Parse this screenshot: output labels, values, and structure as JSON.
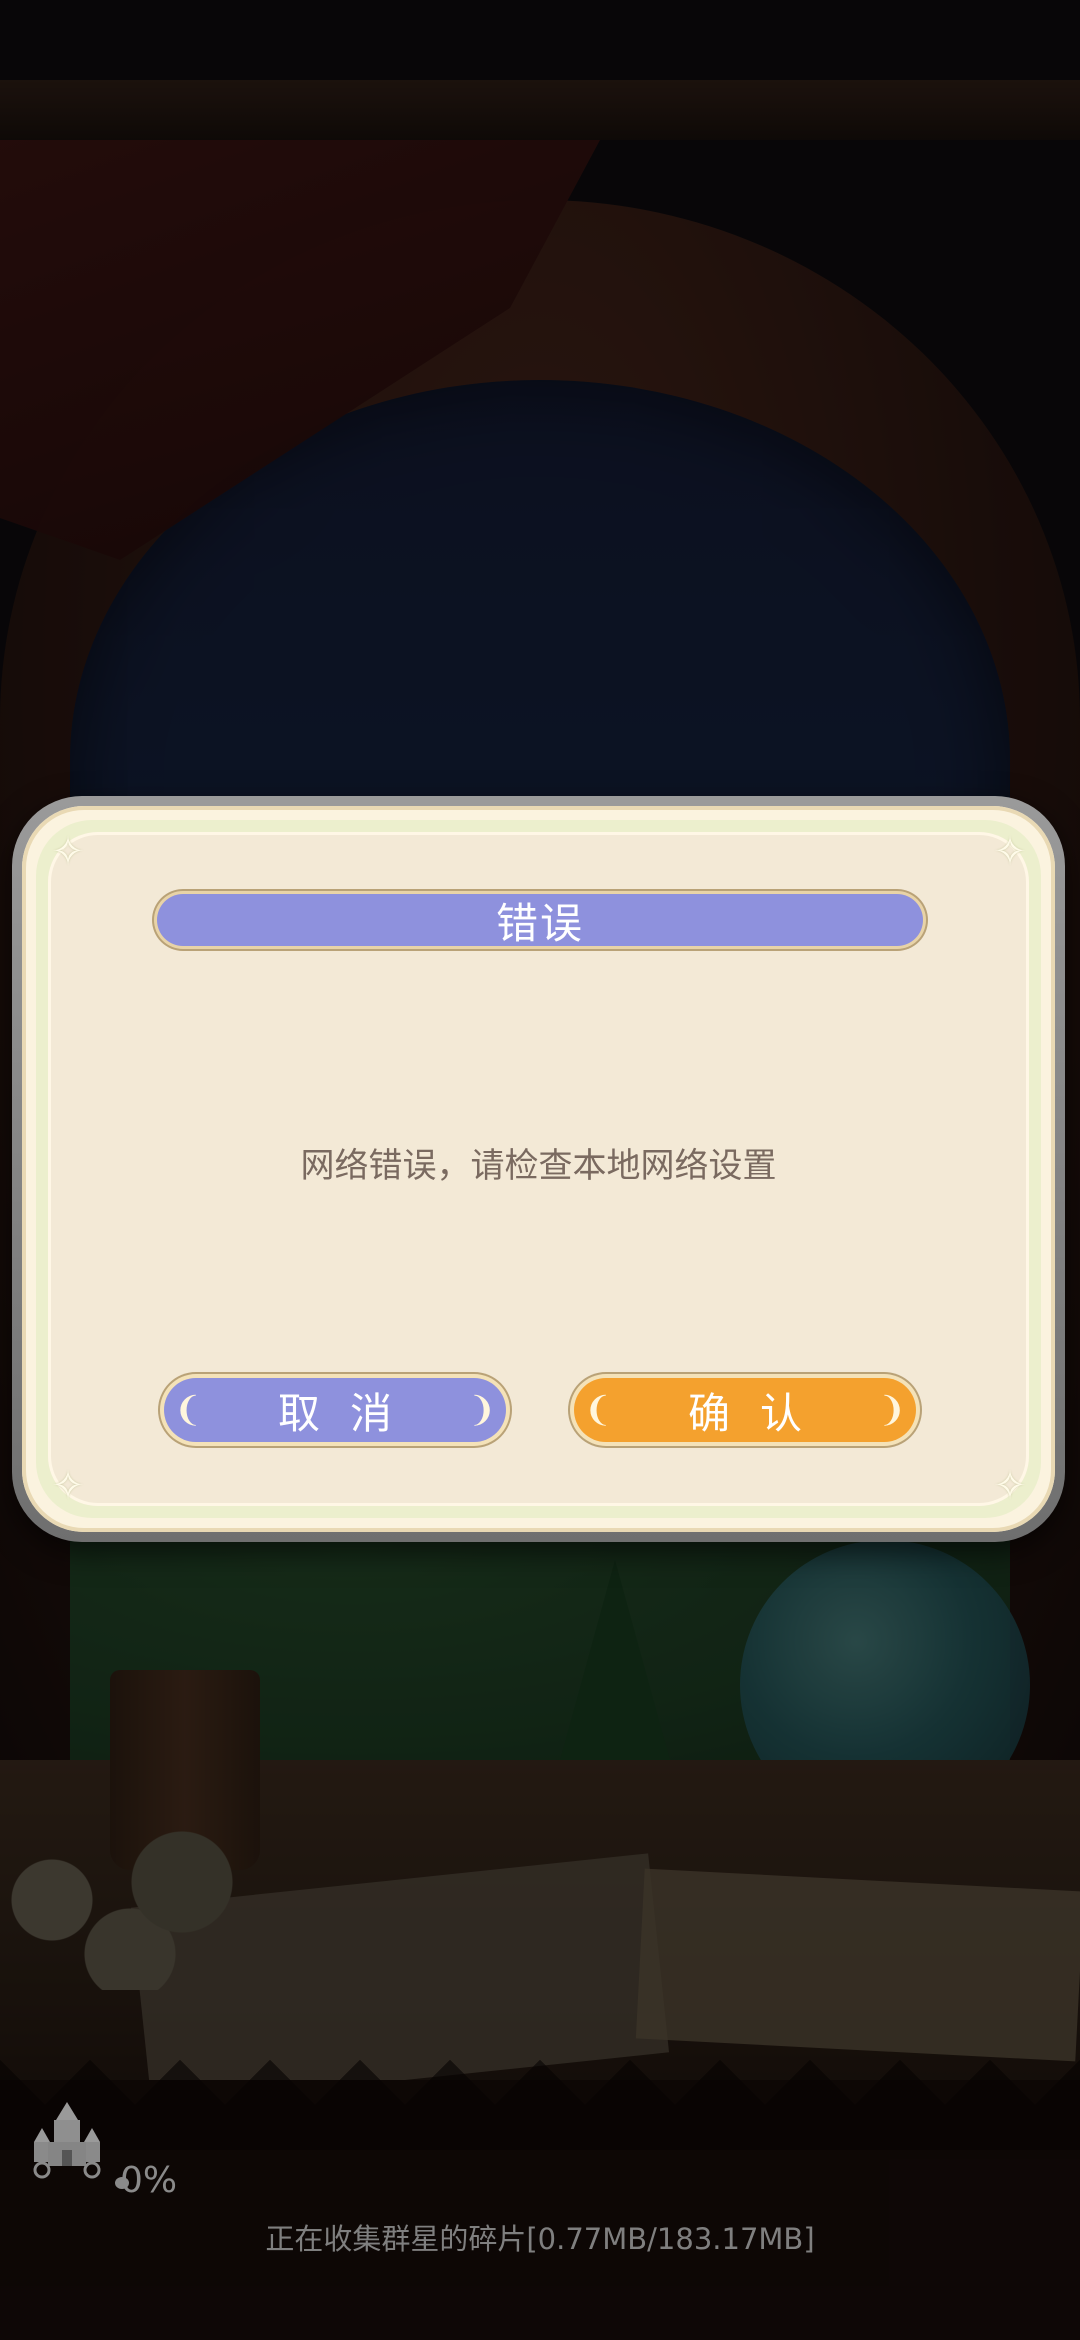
{
  "dialog": {
    "title": "错误",
    "message": "网络错误，请检查本地网络设置",
    "cancel_label": "取消",
    "confirm_label": "确认",
    "title_color": "#8e91dd",
    "cancel_color": "#8e91dd",
    "confirm_color": "#f4a12e",
    "panel_color": "#f3e9d6"
  },
  "loading": {
    "percent": "0%",
    "status": "正在收集群星的碎片[0.77MB/183.17MB]",
    "progress": 0,
    "icon": "castle-icon"
  }
}
